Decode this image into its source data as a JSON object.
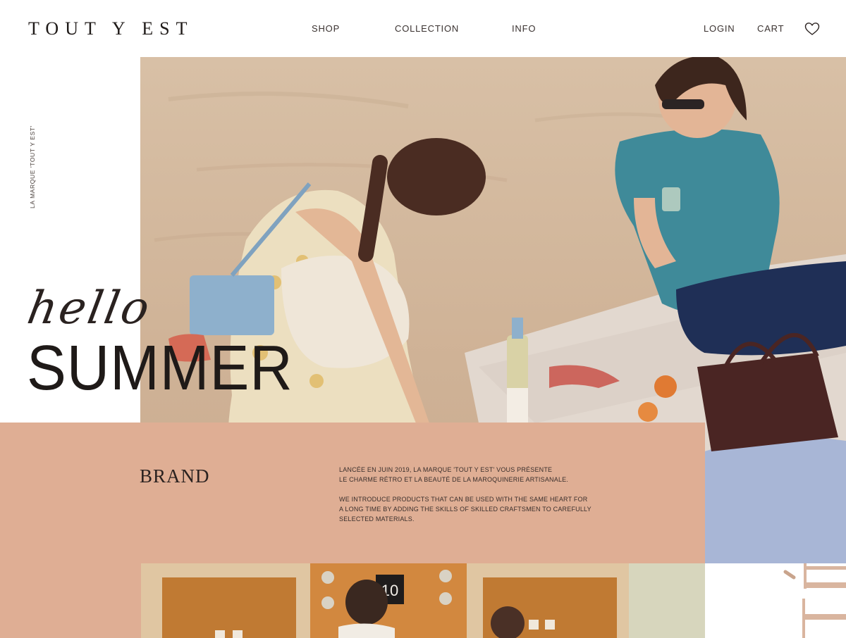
{
  "header": {
    "logo": "TOUT Y EST",
    "nav": [
      "SHOP",
      "COLLECTION",
      "INFO"
    ],
    "login": "LOGIN",
    "cart": "CART",
    "wishlist_icon": "heart-icon"
  },
  "side_label": "LA MARQUE 'TOUT Y EST'",
  "hero": {
    "hello": "hello",
    "summer": "SUMMER",
    "photo": "beach-picnic-photo"
  },
  "brand": {
    "title": "BRAND",
    "paragraph1_line1": "LANCÉE EN JUIN 2019, LA MARQUE 'TOUT Y EST' VOUS PRÉSENTE",
    "paragraph1_line2": "LE CHARME RÉTRO ET LA BEAUTÉ DE LA MAROQUINERIE ARTISANALE.",
    "paragraph2_line1": "WE INTRODUCE PRODUCTS THAT CAN BE USED WITH THE SAME HEART FOR",
    "paragraph2_line2": "A LONG TIME BY ADDING THE SKILLS OF SKILLED CRAFTSMEN TO CAREFULLY",
    "paragraph2_line3": "SELECTED MATERIALS."
  },
  "second_photo": {
    "sign_number": "10"
  },
  "colors": {
    "accent_panel": "#dfae94",
    "text_dark": "#1f1a18",
    "deco_tan": "#d9b59f"
  }
}
